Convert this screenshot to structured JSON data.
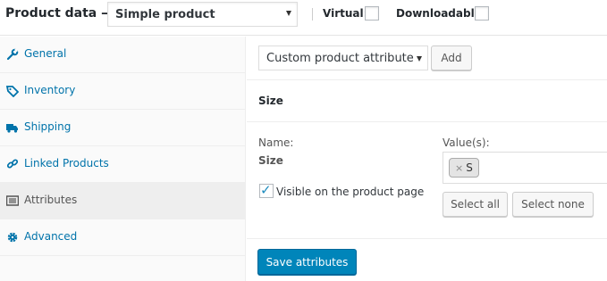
{
  "header": {
    "title": "Product data —",
    "product_type": "Simple product",
    "virtual_label": "Virtual:",
    "downloadable_label": "Downloadable:"
  },
  "sidebar": {
    "items": [
      {
        "label": "General",
        "icon": "wrench-icon"
      },
      {
        "label": "Inventory",
        "icon": "tag-icon"
      },
      {
        "label": "Shipping",
        "icon": "truck-icon"
      },
      {
        "label": "Linked Products",
        "icon": "link-icon"
      },
      {
        "label": "Attributes",
        "icon": "list-icon",
        "active": true
      },
      {
        "label": "Advanced",
        "icon": "gear-icon"
      }
    ]
  },
  "toolbar": {
    "attribute_select": "Custom product attribute",
    "add_label": "Add"
  },
  "attribute": {
    "title": "Size",
    "name_label": "Name:",
    "name_value": "Size",
    "values_label": "Value(s):",
    "values": [
      "S"
    ],
    "visible_label": "Visible on the product page",
    "visible_checked": true,
    "select_all_label": "Select all",
    "select_none_label": "Select none"
  },
  "save_label": "Save attributes",
  "colors": {
    "link": "#0073aa",
    "primary": "#0085ba"
  }
}
